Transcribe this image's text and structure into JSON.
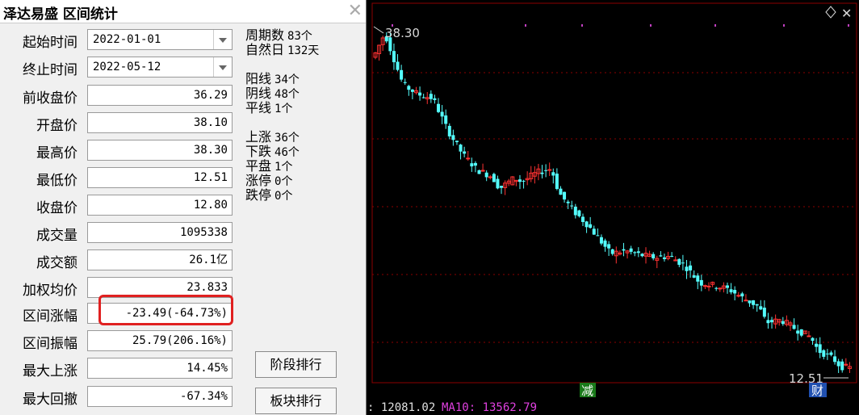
{
  "dialog": {
    "title": "泽达易盛 区间统计",
    "start_label": "起始时间",
    "start_value": "2022-01-01",
    "end_label": "终止时间",
    "end_value": "2022-05-12",
    "rows": [
      {
        "label": "前收盘价",
        "value": "36.29"
      },
      {
        "label": "开盘价",
        "value": "38.10"
      },
      {
        "label": "最高价",
        "value": "38.30"
      },
      {
        "label": "最低价",
        "value": "12.51"
      },
      {
        "label": "收盘价",
        "value": "12.80"
      },
      {
        "label": "成交量",
        "value": "1095338"
      },
      {
        "label": "成交额",
        "value": "26.1亿"
      },
      {
        "label": "加权均价",
        "value": "23.833"
      },
      {
        "label": "区间涨幅",
        "value": "-23.49(-64.73%)"
      },
      {
        "label": "区间振幅",
        "value": "25.79(206.16%)"
      },
      {
        "label": "最大上涨",
        "value": "14.45%"
      },
      {
        "label": "最大回撤",
        "value": "-67.34%"
      }
    ],
    "stats": [
      {
        "label": "周期数",
        "value": "83个"
      },
      {
        "label": "自然日",
        "value": "132天"
      },
      {
        "label": "阳线",
        "value": "34个"
      },
      {
        "label": "阴线",
        "value": "48个"
      },
      {
        "label": "平线",
        "value": "1个"
      },
      {
        "label": "上涨",
        "value": "36个"
      },
      {
        "label": "下跌",
        "value": "46个"
      },
      {
        "label": "平盘",
        "value": "1个"
      },
      {
        "label": "涨停",
        "value": "0个"
      },
      {
        "label": "跌停",
        "value": "0个"
      }
    ],
    "btn_stage": "阶段排行",
    "btn_block": "板块排行"
  },
  "chart": {
    "high_label": "38.30",
    "low_label": "12.51",
    "marker_jian": "减",
    "marker_cai": "财",
    "colors": {
      "up": "#ff3232",
      "down": "#54ffff",
      "grid": "#8b0000"
    }
  },
  "bottom": {
    "left_text": ": 12081.02",
    "ma_text": "MA10: 13562.79"
  }
}
